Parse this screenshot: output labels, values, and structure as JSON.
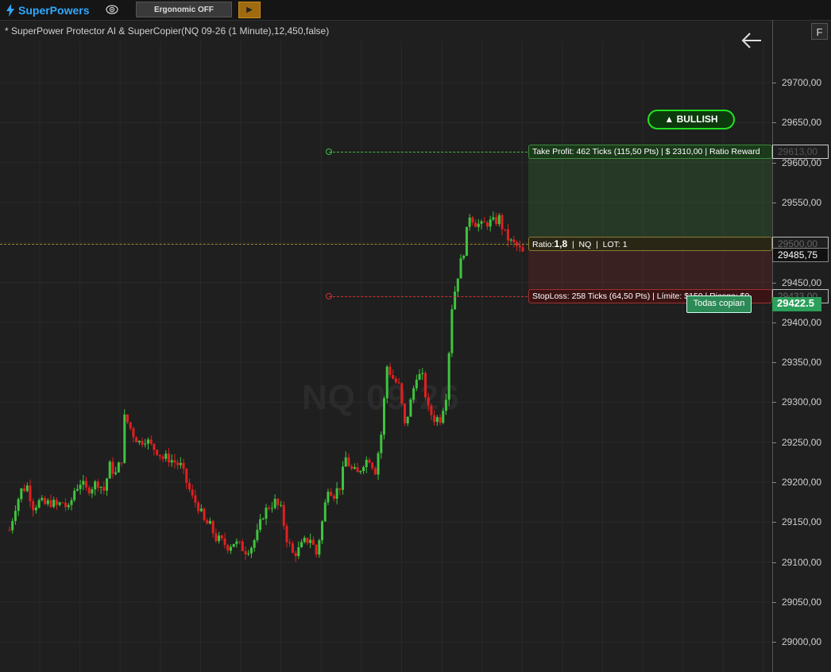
{
  "toolbar": {
    "brand_name": "SuperPowers",
    "ergonomic_label": "Ergonomic OFF",
    "play_symbol": "▶"
  },
  "chart": {
    "title": "* SuperPower Protector AI & SuperCopier(NQ 09-26 (1 Minute),12,450,false)",
    "watermark": "NQ 09-26",
    "f_button": "F"
  },
  "price_axis": {
    "labels": [
      "29700,00",
      "29650,00",
      "29600,00",
      "29550,00",
      "29500,00",
      "29450,00",
      "29400,00",
      "29350,00",
      "29300,00",
      "29250,00",
      "29200,00",
      "29150,00",
      "29100,00",
      "29050,00",
      "29000,00"
    ],
    "tp_price": "29613,00",
    "ratio_price": "29500,00",
    "current_price": "29485,75",
    "sl_price": "29433,00",
    "last_price": "29422.5"
  },
  "orders": {
    "tp_label": "Take Profit: 462 Ticks (115,50 Pts)  |  $ 2310,00  |  Ratio Reward",
    "ratio_prefix": "Ratio:",
    "ratio_value": "1,8",
    "ratio_suffix": "  |  NQ  |  LOT: 1",
    "sl_label": "StopLoss: 258 Ticks (64,50 Pts)  |  Límite: $150  |  Riesgo: $0"
  },
  "badges": {
    "bullish": "▲  BULLISH",
    "todas_copian": "Todas copian"
  },
  "colors": {
    "background": "#1f1f1f",
    "brand": "#2fa8ff",
    "bull_candle": "#3fc43f",
    "bear_candle": "#e02020",
    "take_profit": "#3fbf3f",
    "stop_loss": "#d03030",
    "bullish_border": "#22e022"
  },
  "chart_data": {
    "type": "candlestick",
    "symbol": "NQ 09-26",
    "timeframe": "1 Minute",
    "ylim": [
      29000,
      29725
    ],
    "close_path": [
      [
        0,
        29140
      ],
      [
        2,
        29170
      ],
      [
        4,
        29190
      ],
      [
        6,
        29195
      ],
      [
        8,
        29170
      ],
      [
        10,
        29175
      ],
      [
        12,
        29172
      ],
      [
        14,
        29175
      ],
      [
        16,
        29170
      ],
      [
        18,
        29175
      ],
      [
        20,
        29165
      ],
      [
        22,
        29190
      ],
      [
        24,
        29200
      ],
      [
        26,
        29190
      ],
      [
        28,
        29195
      ],
      [
        30,
        29200
      ],
      [
        32,
        29190
      ],
      [
        34,
        29220
      ],
      [
        36,
        29210
      ],
      [
        38,
        29230
      ],
      [
        39,
        29280
      ],
      [
        40,
        29275
      ],
      [
        42,
        29260
      ],
      [
        44,
        29250
      ],
      [
        46,
        29255
      ],
      [
        48,
        29245
      ],
      [
        50,
        29240
      ],
      [
        52,
        29230
      ],
      [
        54,
        29230
      ],
      [
        56,
        29225
      ],
      [
        58,
        29220
      ],
      [
        60,
        29200
      ],
      [
        62,
        29180
      ],
      [
        64,
        29170
      ],
      [
        66,
        29150
      ],
      [
        68,
        29145
      ],
      [
        70,
        29130
      ],
      [
        72,
        29125
      ],
      [
        74,
        29120
      ],
      [
        76,
        29125
      ],
      [
        78,
        29120
      ],
      [
        80,
        29115
      ],
      [
        82,
        29120
      ],
      [
        84,
        29135
      ],
      [
        86,
        29160
      ],
      [
        88,
        29170
      ],
      [
        90,
        29175
      ],
      [
        92,
        29165
      ],
      [
        94,
        29130
      ],
      [
        96,
        29110
      ],
      [
        98,
        29115
      ],
      [
        100,
        29125
      ],
      [
        102,
        29130
      ],
      [
        104,
        29110
      ],
      [
        106,
        29150
      ],
      [
        108,
        29195
      ],
      [
        110,
        29185
      ],
      [
        112,
        29195
      ],
      [
        114,
        29230
      ],
      [
        116,
        29215
      ],
      [
        118,
        29210
      ],
      [
        120,
        29225
      ],
      [
        122,
        29230
      ],
      [
        124,
        29215
      ],
      [
        126,
        29260
      ],
      [
        128,
        29345
      ],
      [
        130,
        29330
      ],
      [
        132,
        29320
      ],
      [
        134,
        29270
      ],
      [
        136,
        29300
      ],
      [
        138,
        29335
      ],
      [
        140,
        29330
      ],
      [
        142,
        29290
      ],
      [
        144,
        29280
      ],
      [
        146,
        29280
      ],
      [
        148,
        29310
      ],
      [
        150,
        29420
      ],
      [
        152,
        29460
      ],
      [
        154,
        29490
      ],
      [
        156,
        29535
      ],
      [
        158,
        29525
      ],
      [
        160,
        29520
      ],
      [
        162,
        29525
      ],
      [
        164,
        29525
      ],
      [
        166,
        29530
      ],
      [
        168,
        29510
      ],
      [
        170,
        29500
      ],
      [
        172,
        29495
      ],
      [
        174,
        29486
      ]
    ]
  }
}
